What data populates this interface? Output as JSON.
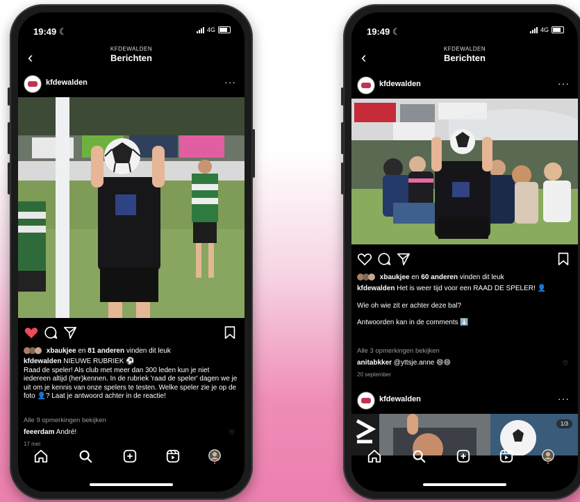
{
  "left_phone": {
    "status": {
      "time": "19:49",
      "network": "4G"
    },
    "header": {
      "subtitle": "KFDEWALDEN",
      "title": "Berichten"
    },
    "post": {
      "username": "kfdewalden",
      "liked": true,
      "likes": {
        "user": "xbaukjee",
        "middle": " en ",
        "count": "81 anderen",
        "suffix": " vinden dit leuk"
      },
      "caption_user": "kfdewalden",
      "caption_text": " NIEUWE RUBRIEK ⚽",
      "caption_body": "Raad de speler! Als club met meer dan 300 leden kun je niet iedereen altijd (her)kennen. In de rubriek 'raad de speler' dagen we je uit om je kennis van onze spelers te testen. Welke speler zie je op de foto 👤? Laat je antwoord achter in de reactie!",
      "view_comments": "Alle 9 opmerkingen bekijken",
      "comment_user": "feeerdam",
      "comment_text": " André!",
      "date": "17 mei"
    }
  },
  "right_phone": {
    "status": {
      "time": "19:49",
      "network": "4G"
    },
    "header": {
      "subtitle": "KFDEWALDEN",
      "title": "Berichten"
    },
    "post": {
      "username": "kfdewalden",
      "liked": false,
      "likes": {
        "user": "xbaukjee",
        "middle": " en ",
        "count": "60 anderen",
        "suffix": " vinden dit leuk"
      },
      "caption_user": "kfdewalden",
      "caption_text": " Het is weer tijd voor een RAAD DE SPELER! 👤",
      "caption_line2": "Wie oh wie zit er achter deze bal?",
      "caption_line3": "Antwoorden kan in de comments ⬇️",
      "view_comments": "Alle 3 opmerkingen bekijken",
      "comment_user": "anitabkker",
      "comment_text": " @yttsje.anne 😄😄",
      "date": "20 september"
    },
    "next_post": {
      "username": "kfdewalden",
      "counter": "1/3"
    }
  },
  "colors": {
    "like_red": "#ed4956",
    "background_pink": "#ec7fae"
  },
  "tabbar_icons": [
    "home-icon",
    "search-icon",
    "new-post-icon",
    "reels-icon",
    "profile-icon"
  ]
}
